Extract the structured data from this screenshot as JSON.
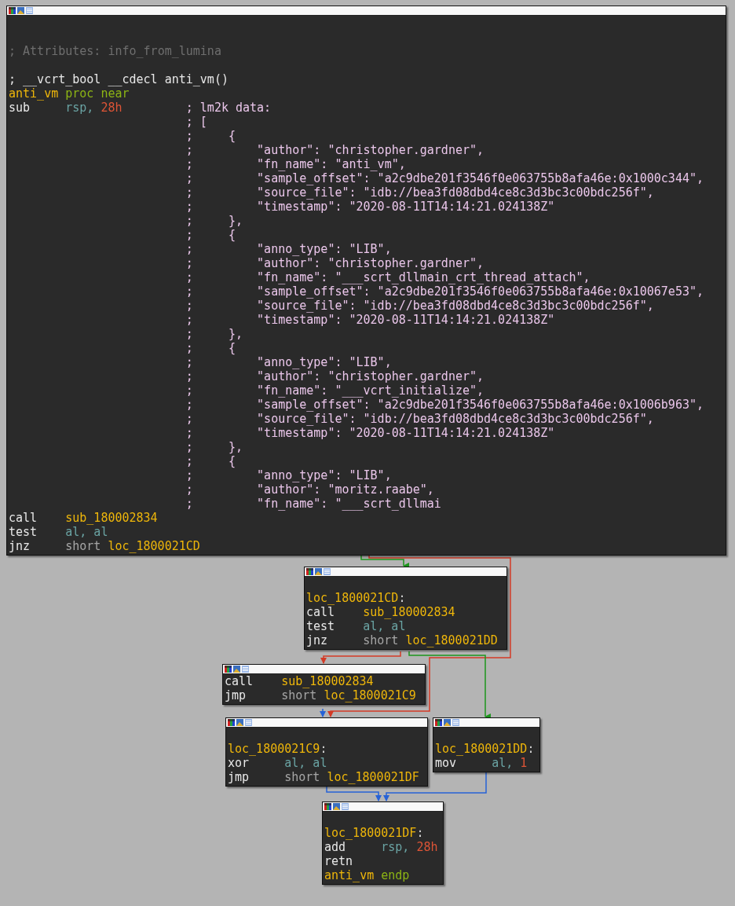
{
  "nodes": [
    {
      "lines": [
        {
          "tokens": [
            {
              "text": "; Attributes: info_from_lumina",
              "kind": "attribute_comment"
            }
          ]
        },
        {
          "tokens": [
            {
              "text": "; __vcrt_bool __cdecl anti_vm()",
              "kind": "signature_comment"
            }
          ]
        },
        {
          "tokens": [
            {
              "text": "anti_vm",
              "kind": "name"
            },
            {
              "text": "proc near",
              "kind": "keyword"
            }
          ]
        },
        {
          "tokens": [
            {
              "text": "sub",
              "kind": "op"
            },
            {
              "text": "rsp,",
              "kind": "register"
            },
            {
              "text": "28h",
              "kind": "number"
            }
          ],
          "annotation": "; lm2k data:"
        },
        {
          "annotation": "; ["
        },
        {
          "annotation": ";     {"
        },
        {
          "annotation": ";         \"author\": \"christopher.gardner\","
        },
        {
          "annotation": ";         \"fn_name\": \"anti_vm\","
        },
        {
          "annotation": ";         \"sample_offset\": \"a2c9dbe201f3546f0e063755b8afa46e:0x1000c344\","
        },
        {
          "annotation": ";         \"source_file\": \"idb://bea3fd08dbd4ce8c3d3bc3c00bdc256f\","
        },
        {
          "annotation": ";         \"timestamp\": \"2020-08-11T14:14:21.024138Z\""
        },
        {
          "annotation": ";     },"
        },
        {
          "annotation": ";     {"
        },
        {
          "annotation": ";         \"anno_type\": \"LIB\","
        },
        {
          "annotation": ";         \"author\": \"christopher.gardner\","
        },
        {
          "annotation": ";         \"fn_name\": \"___scrt_dllmain_crt_thread_attach\","
        },
        {
          "annotation": ";         \"sample_offset\": \"a2c9dbe201f3546f0e063755b8afa46e:0x10067e53\","
        },
        {
          "annotation": ";         \"source_file\": \"idb://bea3fd08dbd4ce8c3d3bc3c00bdc256f\","
        },
        {
          "annotation": ";         \"timestamp\": \"2020-08-11T14:14:21.024138Z\""
        },
        {
          "annotation": ";     },"
        },
        {
          "annotation": ";     {"
        },
        {
          "annotation": ";         \"anno_type\": \"LIB\","
        },
        {
          "annotation": ";         \"author\": \"christopher.gardner\","
        },
        {
          "annotation": ";         \"fn_name\": \"___vcrt_initialize\","
        },
        {
          "annotation": ";         \"sample_offset\": \"a2c9dbe201f3546f0e063755b8afa46e:0x1006b963\","
        },
        {
          "annotation": ";         \"source_file\": \"idb://bea3fd08dbd4ce8c3d3bc3c00bdc256f\","
        },
        {
          "annotation": ";         \"timestamp\": \"2020-08-11T14:14:21.024138Z\""
        },
        {
          "annotation": ";     },"
        },
        {
          "annotation": ";     {"
        },
        {
          "annotation": ";         \"anno_type\": \"LIB\","
        },
        {
          "annotation": ";         \"author\": \"moritz.raabe\","
        },
        {
          "annotation": ";         \"fn_name\": \"___scrt_dllmai"
        },
        {
          "tokens": [
            {
              "text": "call",
              "kind": "op"
            },
            {
              "text": "sub_180002834",
              "kind": "name"
            }
          ]
        },
        {
          "tokens": [
            {
              "text": "test",
              "kind": "op"
            },
            {
              "text": "al, al",
              "kind": "register"
            }
          ]
        },
        {
          "tokens": [
            {
              "text": "jnz",
              "kind": "op"
            },
            {
              "text": "short",
              "kind": "plain"
            },
            {
              "text": "loc_1800021CD",
              "kind": "name"
            }
          ]
        }
      ]
    },
    {
      "lines": [
        {
          "tokens": [
            {
              "text": "loc_1800021CD",
              "kind": "name"
            },
            {
              "text": ":",
              "kind": "punct"
            }
          ]
        },
        {
          "tokens": [
            {
              "text": "call",
              "kind": "op"
            },
            {
              "text": "sub_180002834",
              "kind": "name"
            }
          ]
        },
        {
          "tokens": [
            {
              "text": "test",
              "kind": "op"
            },
            {
              "text": "al, al",
              "kind": "register"
            }
          ]
        },
        {
          "tokens": [
            {
              "text": "jnz",
              "kind": "op"
            },
            {
              "text": "short",
              "kind": "plain"
            },
            {
              "text": "loc_1800021DD",
              "kind": "name"
            }
          ]
        }
      ]
    },
    {
      "lines": [
        {
          "tokens": [
            {
              "text": "call",
              "kind": "op"
            },
            {
              "text": "sub_180002834",
              "kind": "name"
            }
          ]
        },
        {
          "tokens": [
            {
              "text": "jmp",
              "kind": "op"
            },
            {
              "text": "short",
              "kind": "plain"
            },
            {
              "text": "loc_1800021C9",
              "kind": "name"
            }
          ]
        }
      ]
    },
    {
      "lines": [
        {
          "tokens": [
            {
              "text": "loc_1800021C9",
              "kind": "name"
            },
            {
              "text": ":",
              "kind": "punct"
            }
          ]
        },
        {
          "tokens": [
            {
              "text": "xor",
              "kind": "op"
            },
            {
              "text": "al, al",
              "kind": "register"
            }
          ]
        },
        {
          "tokens": [
            {
              "text": "jmp",
              "kind": "op"
            },
            {
              "text": "short",
              "kind": "plain"
            },
            {
              "text": "loc_1800021DF",
              "kind": "name"
            }
          ]
        }
      ]
    },
    {
      "lines": [
        {
          "tokens": [
            {
              "text": "loc_1800021DD",
              "kind": "name"
            },
            {
              "text": ":",
              "kind": "punct"
            }
          ]
        },
        {
          "tokens": [
            {
              "text": "mov",
              "kind": "op"
            },
            {
              "text": "al,",
              "kind": "register"
            },
            {
              "text": "1",
              "kind": "number"
            }
          ]
        }
      ]
    },
    {
      "lines": [
        {
          "tokens": [
            {
              "text": "loc_1800021DF",
              "kind": "name"
            },
            {
              "text": ":",
              "kind": "punct"
            }
          ]
        },
        {
          "tokens": [
            {
              "text": "add",
              "kind": "op"
            },
            {
              "text": "rsp,",
              "kind": "register"
            },
            {
              "text": "28h",
              "kind": "number"
            }
          ]
        },
        {
          "tokens": [
            {
              "text": "retn",
              "kind": "op"
            }
          ]
        },
        {
          "tokens": [
            {
              "text": "anti_vm",
              "kind": "name"
            },
            {
              "text": "endp",
              "kind": "keyword"
            }
          ]
        }
      ]
    }
  ]
}
